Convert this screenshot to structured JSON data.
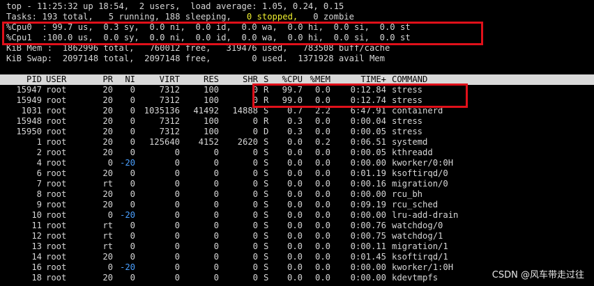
{
  "summary": {
    "top_line": "top - 11:25:32 up 18:54,  2 users,  load average: 1.05, 0.24, 0.15",
    "tasks_pre": "Tasks: 193 total,   5 running, 188 sleeping,   ",
    "tasks_stopped": "0 stopped,",
    "tasks_post": "   0 zombie",
    "cpu0": "%Cpu0  : 99.7 us,  0.3 sy,  0.0 ni,  0.0 id,  0.0 wa,  0.0 hi,  0.0 si,  0.0 st",
    "cpu1": "%Cpu1  :100.0 us,  0.0 sy,  0.0 ni,  0.0 id,  0.0 wa,  0.0 hi,  0.0 si,  0.0 st",
    "mem": "KiB Mem :  1862996 total,   760012 free,   319476 used,   783508 buff/cache",
    "swap": "KiB Swap:  2097148 total,  2097148 free,        0 used.  1371928 avail Mem"
  },
  "columns": [
    "PID",
    "USER",
    "PR",
    "NI",
    "VIRT",
    "RES",
    "SHR",
    "S",
    "%CPU",
    "%MEM",
    "TIME+",
    "COMMAND"
  ],
  "processes": [
    {
      "pid": "15947",
      "user": "root",
      "pr": "20",
      "ni": "0",
      "virt": "7312",
      "res": "100",
      "shr": "0",
      "s": "R",
      "cpu": "99.7",
      "mem": "0.0",
      "time": "0:12.84",
      "cmd": "stress"
    },
    {
      "pid": "15949",
      "user": "root",
      "pr": "20",
      "ni": "0",
      "virt": "7312",
      "res": "100",
      "shr": "0",
      "s": "R",
      "cpu": "99.0",
      "mem": "0.0",
      "time": "0:12.74",
      "cmd": "stress"
    },
    {
      "pid": "1031",
      "user": "root",
      "pr": "20",
      "ni": "0",
      "virt": "1035136",
      "res": "41492",
      "shr": "14888",
      "s": "S",
      "cpu": "0.7",
      "mem": "2.2",
      "time": "6:47.91",
      "cmd": "containerd"
    },
    {
      "pid": "15948",
      "user": "root",
      "pr": "20",
      "ni": "0",
      "virt": "7312",
      "res": "100",
      "shr": "0",
      "s": "R",
      "cpu": "0.3",
      "mem": "0.0",
      "time": "0:00.04",
      "cmd": "stress"
    },
    {
      "pid": "15950",
      "user": "root",
      "pr": "20",
      "ni": "0",
      "virt": "7312",
      "res": "100",
      "shr": "0",
      "s": "D",
      "cpu": "0.3",
      "mem": "0.0",
      "time": "0:00.05",
      "cmd": "stress"
    },
    {
      "pid": "1",
      "user": "root",
      "pr": "20",
      "ni": "0",
      "virt": "125640",
      "res": "4152",
      "shr": "2620",
      "s": "S",
      "cpu": "0.0",
      "mem": "0.2",
      "time": "0:06.51",
      "cmd": "systemd"
    },
    {
      "pid": "2",
      "user": "root",
      "pr": "20",
      "ni": "0",
      "virt": "0",
      "res": "0",
      "shr": "0",
      "s": "S",
      "cpu": "0.0",
      "mem": "0.0",
      "time": "0:00.05",
      "cmd": "kthreadd"
    },
    {
      "pid": "4",
      "user": "root",
      "pr": "0",
      "ni": "-20",
      "virt": "0",
      "res": "0",
      "shr": "0",
      "s": "S",
      "cpu": "0.0",
      "mem": "0.0",
      "time": "0:00.00",
      "cmd": "kworker/0:0H"
    },
    {
      "pid": "6",
      "user": "root",
      "pr": "20",
      "ni": "0",
      "virt": "0",
      "res": "0",
      "shr": "0",
      "s": "S",
      "cpu": "0.0",
      "mem": "0.0",
      "time": "0:01.19",
      "cmd": "ksoftirqd/0"
    },
    {
      "pid": "7",
      "user": "root",
      "pr": "rt",
      "ni": "0",
      "virt": "0",
      "res": "0",
      "shr": "0",
      "s": "S",
      "cpu": "0.0",
      "mem": "0.0",
      "time": "0:00.16",
      "cmd": "migration/0"
    },
    {
      "pid": "8",
      "user": "root",
      "pr": "20",
      "ni": "0",
      "virt": "0",
      "res": "0",
      "shr": "0",
      "s": "S",
      "cpu": "0.0",
      "mem": "0.0",
      "time": "0:00.00",
      "cmd": "rcu_bh"
    },
    {
      "pid": "9",
      "user": "root",
      "pr": "20",
      "ni": "0",
      "virt": "0",
      "res": "0",
      "shr": "0",
      "s": "S",
      "cpu": "0.0",
      "mem": "0.0",
      "time": "0:09.19",
      "cmd": "rcu_sched"
    },
    {
      "pid": "10",
      "user": "root",
      "pr": "0",
      "ni": "-20",
      "virt": "0",
      "res": "0",
      "shr": "0",
      "s": "S",
      "cpu": "0.0",
      "mem": "0.0",
      "time": "0:00.00",
      "cmd": "lru-add-drain"
    },
    {
      "pid": "11",
      "user": "root",
      "pr": "rt",
      "ni": "0",
      "virt": "0",
      "res": "0",
      "shr": "0",
      "s": "S",
      "cpu": "0.0",
      "mem": "0.0",
      "time": "0:00.76",
      "cmd": "watchdog/0"
    },
    {
      "pid": "12",
      "user": "root",
      "pr": "rt",
      "ni": "0",
      "virt": "0",
      "res": "0",
      "shr": "0",
      "s": "S",
      "cpu": "0.0",
      "mem": "0.0",
      "time": "0:00.75",
      "cmd": "watchdog/1"
    },
    {
      "pid": "13",
      "user": "root",
      "pr": "rt",
      "ni": "0",
      "virt": "0",
      "res": "0",
      "shr": "0",
      "s": "S",
      "cpu": "0.0",
      "mem": "0.0",
      "time": "0:00.11",
      "cmd": "migration/1"
    },
    {
      "pid": "14",
      "user": "root",
      "pr": "20",
      "ni": "0",
      "virt": "0",
      "res": "0",
      "shr": "0",
      "s": "S",
      "cpu": "0.0",
      "mem": "0.0",
      "time": "0:01.45",
      "cmd": "ksoftirqd/1"
    },
    {
      "pid": "16",
      "user": "root",
      "pr": "0",
      "ni": "-20",
      "virt": "0",
      "res": "0",
      "shr": "0",
      "s": "S",
      "cpu": "0.0",
      "mem": "0.0",
      "time": "0:00.00",
      "cmd": "kworker/1:0H"
    },
    {
      "pid": "18",
      "user": "root",
      "pr": "20",
      "ni": "0",
      "virt": "0",
      "res": "0",
      "shr": "0",
      "s": "S",
      "cpu": "0.0",
      "mem": "0.0",
      "time": "0:00.00",
      "cmd": "kdevtmpfs"
    }
  ],
  "colors": {
    "background": "#000000",
    "text": "#d6d6d6",
    "stopped": "#f0f030",
    "negative_nice": "#4aa0ff",
    "highlight": "#e0101a"
  },
  "watermark": "CSDN @风车带走过往"
}
